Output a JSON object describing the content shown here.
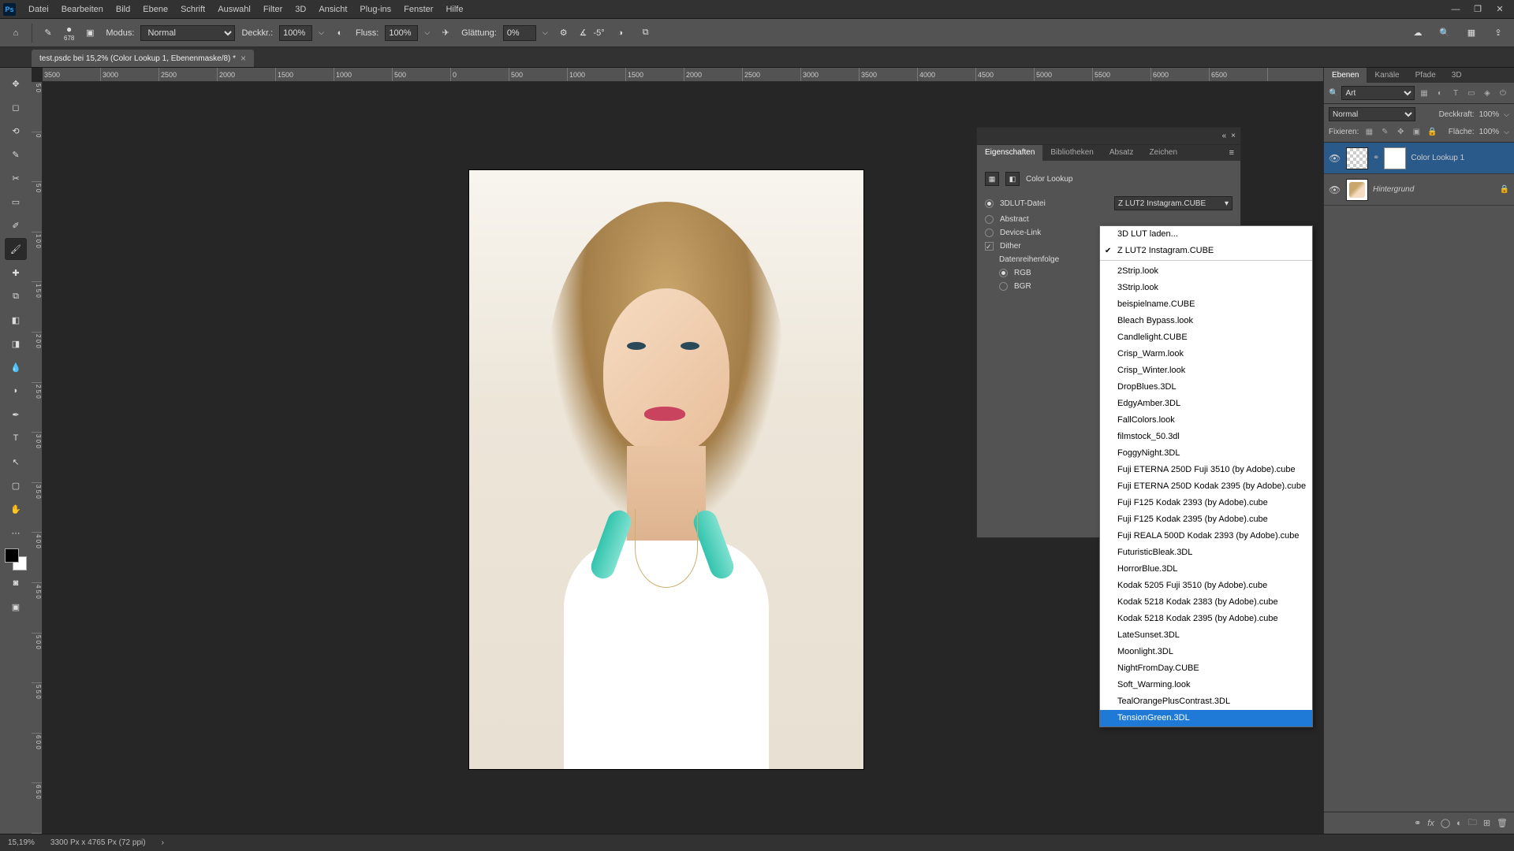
{
  "titlebar": {
    "menus": [
      "Datei",
      "Bearbeiten",
      "Bild",
      "Ebene",
      "Schrift",
      "Auswahl",
      "Filter",
      "3D",
      "Ansicht",
      "Plug-ins",
      "Fenster",
      "Hilfe"
    ]
  },
  "options": {
    "brush_size": "678",
    "mode_label": "Modus:",
    "mode_value": "Normal",
    "opacity_label": "Deckkr.:",
    "opacity_value": "100%",
    "flow_label": "Fluss:",
    "flow_value": "100%",
    "smoothing_label": "Glättung:",
    "smoothing_value": "0%",
    "angle_label": "∡",
    "angle_value": "-5°"
  },
  "tab": {
    "title": "test.psdc bei 15,2% (Color Lookup 1, Ebenenmaske/8) *"
  },
  "ruler_h": [
    "3500",
    "3000",
    "2500",
    "2000",
    "1500",
    "1000",
    "500",
    "0",
    "500",
    "1000",
    "1500",
    "2000",
    "2500",
    "3000",
    "3500",
    "4000",
    "4500",
    "5000",
    "5500",
    "6000",
    "6500"
  ],
  "ruler_v": [
    "5 0",
    "0",
    "5 0",
    "1 0 0",
    "1 5 0",
    "2 0 0",
    "2 5 0",
    "3 0 0",
    "3 5 0",
    "4 0 0",
    "4 5 0",
    "5 0 0",
    "5 5 0",
    "6 0 0",
    "6 5 0"
  ],
  "properties": {
    "tab_eigenschaften": "Eigenschaften",
    "tab_bibliotheken": "Bibliotheken",
    "tab_absatz": "Absatz",
    "tab_zeichen": "Zeichen",
    "title": "Color Lookup",
    "row_3dlut": "3DLUT-Datei",
    "row_abstract": "Abstract",
    "row_devicelink": "Device-Link",
    "row_dither": "Dither",
    "row_order": "Datenreihenfolge",
    "row_rgb": "RGB",
    "row_bgr": "BGR",
    "selected_lut": "Z LUT2 Instagram.CUBE"
  },
  "dropdown": {
    "items": [
      "3D LUT laden...",
      "Z LUT2 Instagram.CUBE",
      "2Strip.look",
      "3Strip.look",
      "beispielname.CUBE",
      "Bleach Bypass.look",
      "Candlelight.CUBE",
      "Crisp_Warm.look",
      "Crisp_Winter.look",
      "DropBlues.3DL",
      "EdgyAmber.3DL",
      "FallColors.look",
      "filmstock_50.3dl",
      "FoggyNight.3DL",
      "Fuji ETERNA 250D Fuji 3510 (by Adobe).cube",
      "Fuji ETERNA 250D Kodak 2395 (by Adobe).cube",
      "Fuji F125 Kodak 2393 (by Adobe).cube",
      "Fuji F125 Kodak 2395 (by Adobe).cube",
      "Fuji REALA 500D Kodak 2393 (by Adobe).cube",
      "FuturisticBleak.3DL",
      "HorrorBlue.3DL",
      "Kodak 5205 Fuji 3510 (by Adobe).cube",
      "Kodak 5218 Kodak 2383 (by Adobe).cube",
      "Kodak 5218 Kodak 2395 (by Adobe).cube",
      "LateSunset.3DL",
      "Moonlight.3DL",
      "NightFromDay.CUBE",
      "Soft_Warming.look",
      "TealOrangePlusContrast.3DL",
      "TensionGreen.3DL"
    ],
    "checked_index": 1,
    "highlight_index": 29,
    "sep_after_indices": [
      1
    ]
  },
  "layers": {
    "tabs": [
      "Ebenen",
      "Kanäle",
      "Pfade",
      "3D"
    ],
    "filter_label": "Art",
    "blend_mode": "Normal",
    "opacity_label": "Deckkraft:",
    "opacity_value": "100%",
    "lock_label": "Fixieren:",
    "fill_label": "Fläche:",
    "fill_value": "100%",
    "items": [
      {
        "name": "Color Lookup 1",
        "active": true,
        "has_mask": true,
        "locked": false,
        "is_bg": false
      },
      {
        "name": "Hintergrund",
        "active": false,
        "has_mask": false,
        "locked": true,
        "is_bg": true
      }
    ]
  },
  "status": {
    "zoom": "15,19%",
    "info": "3300 Px x 4765 Px (72 ppi)"
  }
}
